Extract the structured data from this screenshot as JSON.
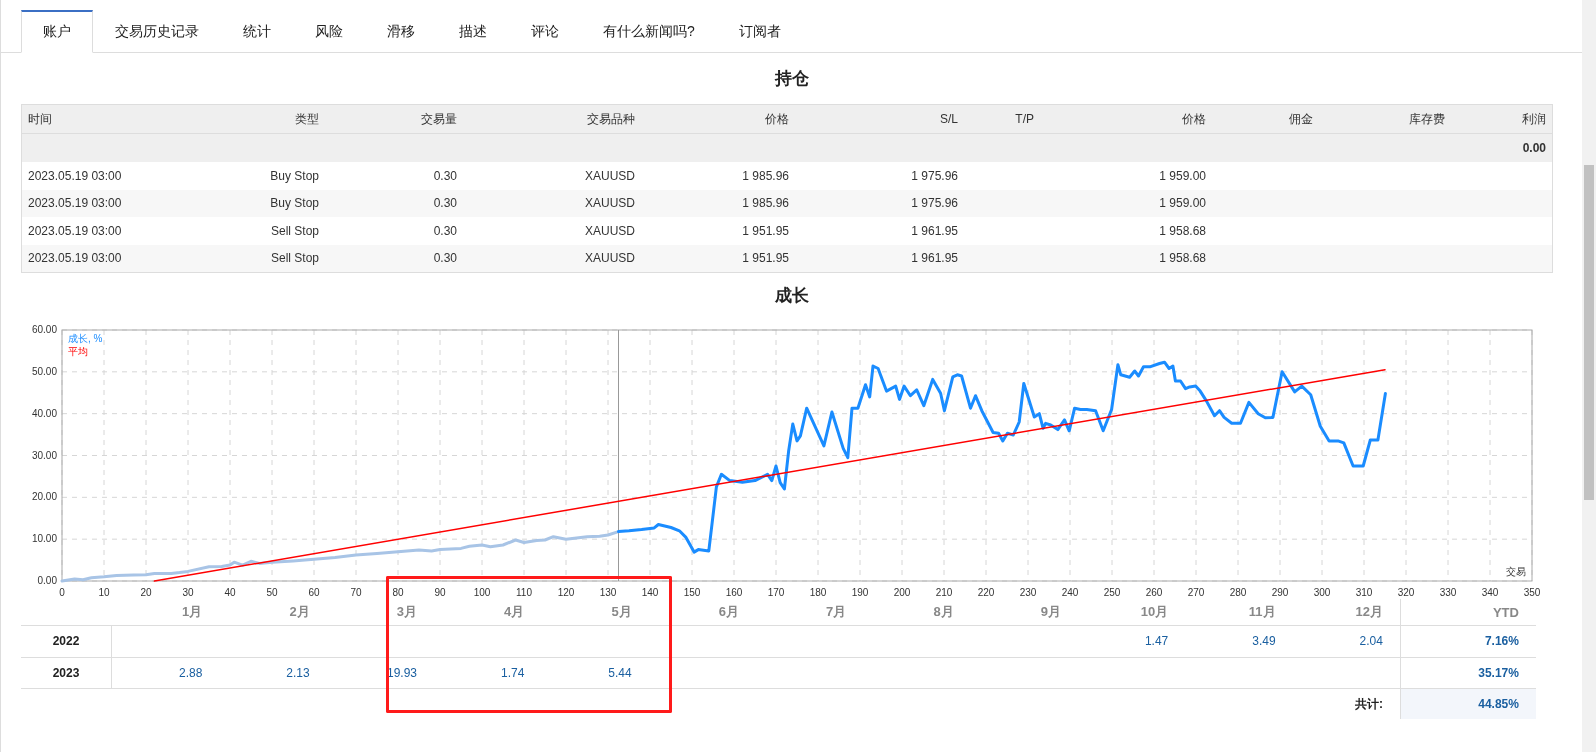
{
  "tabs": [
    {
      "label": "账户",
      "selected": true
    },
    {
      "label": "交易历史记录",
      "selected": false
    },
    {
      "label": "统计",
      "selected": false
    },
    {
      "label": "风险",
      "selected": false
    },
    {
      "label": "滑移",
      "selected": false
    },
    {
      "label": "描述",
      "selected": false
    },
    {
      "label": "评论",
      "selected": false
    },
    {
      "label": "有什么新闻吗?",
      "selected": false
    },
    {
      "label": "订阅者",
      "selected": false
    }
  ],
  "positions": {
    "title": "持仓",
    "columns": [
      "时间",
      "类型",
      "交易量",
      "交易品种",
      "价格",
      "S/L",
      "T/P",
      "价格",
      "佣金",
      "库存费",
      "利润"
    ],
    "summary_profit": "0.00",
    "rows": [
      {
        "time": "2023.05.19 03:00",
        "type": "Buy Stop",
        "volume": "0.30",
        "symbol": "XAUUSD",
        "price": "1 985.96",
        "sl": "1 975.96",
        "market_price": "1 959.00"
      },
      {
        "time": "2023.05.19 03:00",
        "type": "Buy Stop",
        "volume": "0.30",
        "symbol": "XAUUSD",
        "price": "1 985.96",
        "sl": "1 975.96",
        "market_price": "1 959.00"
      },
      {
        "time": "2023.05.19 03:00",
        "type": "Sell Stop",
        "volume": "0.30",
        "symbol": "XAUUSD",
        "price": "1 951.95",
        "sl": "1 961.95",
        "market_price": "1 958.68"
      },
      {
        "time": "2023.05.19 03:00",
        "type": "Sell Stop",
        "volume": "0.30",
        "symbol": "XAUUSD",
        "price": "1 951.95",
        "sl": "1 961.95",
        "market_price": "1 958.68"
      }
    ]
  },
  "growth": {
    "title": "成长",
    "chart_data": {
      "type": "line",
      "xlabel": "交易",
      "xlim": [
        0,
        350
      ],
      "ylim": [
        0,
        60
      ],
      "xticks": [
        0,
        10,
        20,
        30,
        40,
        50,
        60,
        70,
        80,
        90,
        100,
        110,
        120,
        130,
        140,
        150,
        160,
        170,
        180,
        190,
        200,
        210,
        220,
        230,
        240,
        250,
        260,
        270,
        280,
        290,
        300,
        310,
        320,
        330,
        340,
        350
      ],
      "yticks": [
        {
          "value": 0,
          "label": "0.00"
        },
        {
          "value": 10,
          "label": "10.00"
        },
        {
          "value": 20,
          "label": "20.00"
        },
        {
          "value": 30,
          "label": "30.00"
        },
        {
          "value": 40,
          "label": "40.00"
        },
        {
          "value": 50,
          "label": "50.00"
        },
        {
          "value": 60,
          "label": "60.00"
        }
      ],
      "series": [
        {
          "color": "#a8c4e6",
          "x": [
            0,
            3,
            5,
            7,
            10,
            13,
            17,
            20,
            22,
            26,
            28,
            30,
            35,
            38,
            40,
            41,
            43,
            45,
            47,
            50,
            55,
            60,
            65,
            70,
            75,
            80,
            85,
            88,
            90,
            95,
            97,
            100,
            102,
            105,
            108,
            110,
            113,
            115,
            117,
            120,
            125,
            128,
            130,
            132.5
          ],
          "values": [
            0,
            0.5,
            0.3,
            0.8,
            1.0,
            1.3,
            1.4,
            1.5,
            1.8,
            1.8,
            2.0,
            2.3,
            3.4,
            3.5,
            3.8,
            4.5,
            3.8,
            4.7,
            4.2,
            4.5,
            4.8,
            5.2,
            5.6,
            6.2,
            6.6,
            7.0,
            7.4,
            7.2,
            7.5,
            7.8,
            8.3,
            8.6,
            8.2,
            8.6,
            9.8,
            9.2,
            9.7,
            9.8,
            10.6,
            10.0,
            10.6,
            10.7,
            11.0,
            11.8
          ]
        },
        {
          "name": "成长, %",
          "color": "#1a8cff",
          "x": [
            132.5,
            135,
            138,
            141,
            142,
            145,
            147,
            148.5,
            150.5,
            151.5,
            154,
            154.8,
            155.8,
            157,
            159,
            162,
            165,
            168,
            169,
            170,
            171,
            172,
            173,
            174,
            175,
            175.8,
            177.3,
            181.4,
            183.3,
            186,
            187.1,
            188.1,
            189.5,
            191.3,
            192.3,
            193.1,
            194.3,
            196.3,
            198.5,
            199.4,
            200.5,
            202,
            203.5,
            205.2,
            207.3,
            209.2,
            210.1,
            212.1,
            213.2,
            214.2,
            216.3,
            217.5,
            219,
            221.7,
            223,
            224,
            225.1,
            226.5,
            227.9,
            229,
            231.5,
            232.7,
            233.6,
            234.2,
            235.4,
            237.1,
            238.7,
            239.8,
            241.1,
            242.5,
            244,
            246.1,
            247.9,
            249.9,
            251.4,
            252.1,
            254.2,
            255.4,
            256.3,
            257.5,
            259,
            261.3,
            262.5,
            263.6,
            264.5,
            265.1,
            266.3,
            267.5,
            268.5,
            269.9,
            271,
            272.5,
            274.4,
            275.6,
            276.7,
            278.5,
            280.6,
            282.6,
            284.8,
            286.5,
            288.3,
            290.5,
            293.5,
            295.2,
            297.3,
            299.6,
            301.7,
            303.8,
            305.2,
            307.4,
            309.8,
            311.5,
            313.3,
            315.1
          ],
          "values": [
            11.8,
            12.0,
            12.3,
            12.7,
            13.5,
            12.8,
            12.0,
            10.5,
            6.9,
            7.5,
            7.2,
            14,
            22.5,
            25.5,
            24.0,
            23.6,
            24.0,
            25.5,
            24.0,
            27.5,
            23.5,
            22.0,
            31.0,
            37.5,
            33.5,
            34.7,
            41.3,
            32.3,
            40.4,
            31.7,
            29.5,
            41.3,
            41.3,
            46.9,
            44,
            51.4,
            50.8,
            45.4,
            46.6,
            43.4,
            46.6,
            44.3,
            45.7,
            41.9,
            48.2,
            44.9,
            40.7,
            48.8,
            49.3,
            49,
            41.3,
            44.3,
            40.7,
            35.5,
            35.3,
            33.5,
            35.3,
            34.9,
            38,
            47.2,
            39.2,
            40,
            36.5,
            37.7,
            37.3,
            36.2,
            38.5,
            35.9,
            41.3,
            41,
            41,
            40.7,
            35.9,
            41,
            51.7,
            49.3,
            48.7,
            50.2,
            49,
            51.2,
            51.2,
            52,
            52.3,
            50.8,
            51.4,
            47.8,
            47.8,
            46,
            46.4,
            46.6,
            45.4,
            43,
            39.5,
            40.7,
            39.1,
            37.7,
            37.7,
            42.7,
            40,
            39,
            39.1,
            50,
            45.2,
            46.6,
            44.5,
            37,
            33.5,
            33.5,
            33,
            27.5,
            27.5,
            33.7,
            33.7,
            44.8
          ]
        },
        {
          "name": "平均",
          "color": "#ff0000",
          "x": [
            22,
            315
          ],
          "values": [
            0,
            50.5
          ]
        }
      ],
      "grid": true,
      "ref_lines": [
        {
          "axis": "x",
          "value": 132.5,
          "color": "#999999"
        }
      ]
    }
  },
  "monthly": {
    "months": [
      {
        "label": "1月",
        "highlighted": false
      },
      {
        "label": "2月",
        "highlighted": false
      },
      {
        "label": "3月",
        "highlighted": true
      },
      {
        "label": "4月",
        "highlighted": true
      },
      {
        "label": "5月",
        "highlighted": true
      },
      {
        "label": "6月",
        "highlighted": false
      },
      {
        "label": "7月",
        "highlighted": false
      },
      {
        "label": "8月",
        "highlighted": false
      },
      {
        "label": "9月",
        "highlighted": false
      },
      {
        "label": "10月",
        "highlighted": false
      },
      {
        "label": "11月",
        "highlighted": false
      },
      {
        "label": "12月",
        "highlighted": false
      }
    ],
    "ytd_label": "YTD",
    "years": [
      {
        "year": "2022",
        "values": {
          "oct": "1.47",
          "nov": "3.49",
          "dec": "2.04"
        },
        "ytd": "7.16%"
      },
      {
        "year": "2023",
        "values": {
          "jan": "2.88",
          "feb": "2.13",
          "mar": "19.93",
          "apr": "1.74",
          "may": "5.44"
        },
        "ytd": "35.17%"
      }
    ],
    "total": {
      "label": "共计:",
      "value": "44.85%"
    }
  }
}
